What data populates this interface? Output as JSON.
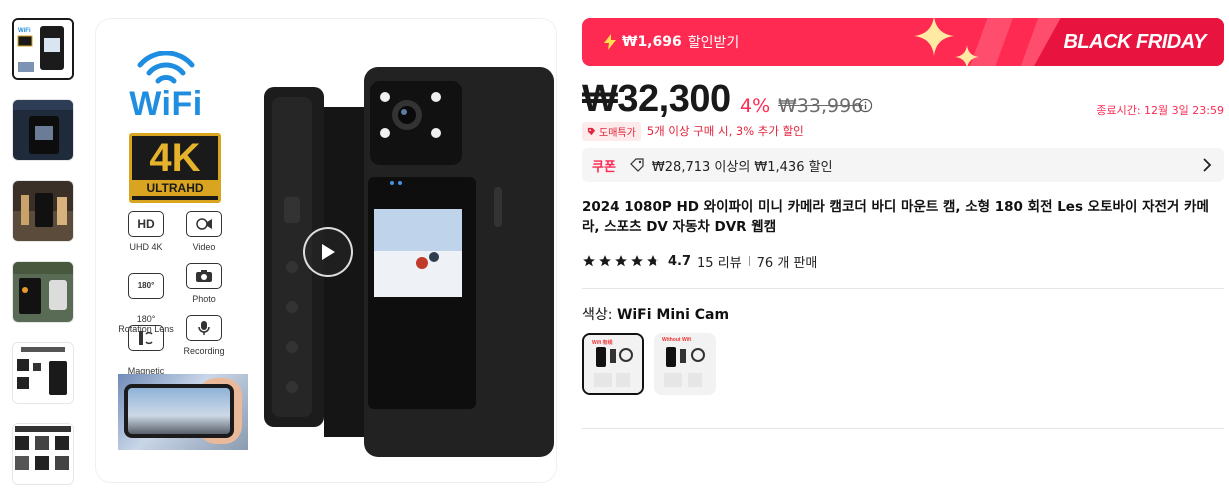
{
  "gallery": {
    "thumbnails": [
      {
        "label": "thumb-1"
      },
      {
        "label": "thumb-2",
        "overlay_text": "HD DRIVING RECORDER"
      },
      {
        "label": "thumb-3",
        "overlay_text": "BUILT-IN LED LIGHTS"
      },
      {
        "label": "thumb-4",
        "overlay_text": "WIFI CONNECTION"
      },
      {
        "label": "thumb-5",
        "overlay_text": "180° LENS ROTATION"
      },
      {
        "label": "thumb-6",
        "overlay_text": "MULTIPLE MODES"
      }
    ],
    "main_image": {
      "wifi_text": "WiFi",
      "badge_big": "4K",
      "badge_small": "ULTRAHD",
      "features": [
        {
          "icon": "HD",
          "label": "UHD 4K"
        },
        {
          "icon": "video-icon",
          "label": "Video"
        },
        {
          "icon": "180°",
          "label": "180°\nRotation Lens"
        },
        {
          "icon": "camera-icon",
          "label": "Photo"
        },
        {
          "icon": "clip-icon",
          "label": "Magnetic\nsuction back clip"
        },
        {
          "icon": "mic-icon",
          "label": "Recording"
        }
      ]
    }
  },
  "banner": {
    "amount": "₩1,696",
    "label": "할인받기",
    "title": "BLACK FRIDAY",
    "color": "#fe2a52"
  },
  "price": {
    "current": "₩32,300",
    "discount": "4%",
    "original": "₩33,996",
    "end_time": "종료시간: 12월 3일 23:59"
  },
  "bulk": {
    "badge": "도매특가",
    "text": "5개 이상 구매 시, 3% 추가 할인"
  },
  "coupon": {
    "label": "쿠폰",
    "text": "₩28,713 이상의 ₩1,436 할인"
  },
  "product": {
    "title": "2024 1080P HD 와이파이 미니 카메라 캠코더 바디 마운트 캠, 소형 180 회전 Les 오토바이 자전거 카메라, 스포츠 DV 자동차 DVR 웹캠",
    "rating": "4.7",
    "reviews": "15 리뷰",
    "sold": "76 개 판매",
    "stars": 4.7
  },
  "color_option": {
    "label": "색상: ",
    "value": "WiFi Mini Cam",
    "swatches": [
      {
        "name": "WiFi Mini Cam",
        "tag": "Wifi 有线",
        "selected": true
      },
      {
        "name": "Without Wifi",
        "tag": "Without Wifi",
        "selected": false
      }
    ]
  }
}
